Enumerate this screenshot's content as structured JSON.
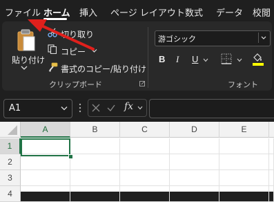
{
  "tabs": {
    "file": "ファイル",
    "home": "ホーム",
    "insert": "挿入",
    "page_layout": "ページ レイアウト",
    "formulas": "数式",
    "data": "データ",
    "review": "校閲"
  },
  "clipboard": {
    "paste": "貼り付け",
    "cut": "切り取り",
    "copy": "コピー",
    "format_painter": "書式のコピー/貼り付け",
    "group_label": "クリップボード"
  },
  "font": {
    "font_name": "游ゴシック",
    "bold": "B",
    "italic": "I",
    "underline": "U",
    "group_label": "フォント"
  },
  "formula_bar": {
    "name_box": "A1",
    "fx": "fx"
  },
  "grid": {
    "columns": [
      "A",
      "B",
      "C",
      "D",
      "E"
    ],
    "rows": [
      "1",
      "2",
      "3",
      "4"
    ],
    "selected_cell": "A1"
  },
  "colors": {
    "accent_green": "#217346",
    "annotation_arrow": "#e0201c",
    "highlight_yellow": "#ffff00",
    "font_color_red": "#e81123"
  }
}
